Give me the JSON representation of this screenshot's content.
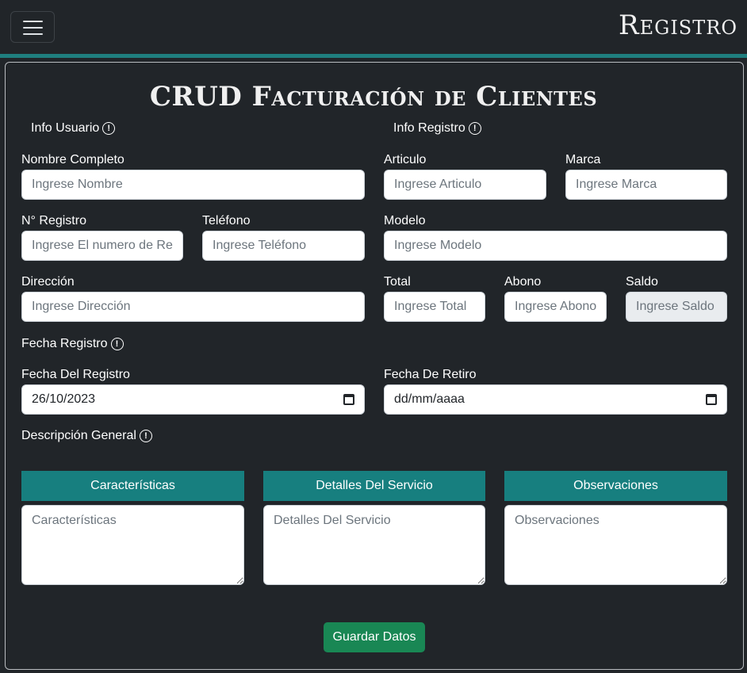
{
  "navbar": {
    "brand": "Registro",
    "menu_icon": "hamburger-menu-icon"
  },
  "page": {
    "title": "CRUD Facturación de Clientes"
  },
  "sections": {
    "info_usuario": "Info Usuario",
    "info_registro": "Info Registro",
    "fecha_registro": "Fecha Registro",
    "descripcion_general": "Descripción General",
    "icon": "info-circle-icon"
  },
  "fields": {
    "nombre": {
      "label": "Nombre Completo",
      "placeholder": "Ingrese Nombre"
    },
    "registro": {
      "label": "N° Registro",
      "placeholder": "Ingrese El numero de Registro"
    },
    "telefono": {
      "label": "Teléfono",
      "placeholder": "Ingrese Teléfono"
    },
    "direccion": {
      "label": "Dirección",
      "placeholder": "Ingrese Dirección"
    },
    "articulo": {
      "label": "Articulo",
      "placeholder": "Ingrese Articulo"
    },
    "marca": {
      "label": "Marca",
      "placeholder": "Ingrese Marca"
    },
    "modelo": {
      "label": "Modelo",
      "placeholder": "Ingrese Modelo"
    },
    "total": {
      "label": "Total",
      "placeholder": "Ingrese Total"
    },
    "abono": {
      "label": "Abono",
      "placeholder": "Ingrese Abono"
    },
    "saldo": {
      "label": "Saldo",
      "placeholder": "Ingrese Saldo"
    },
    "fecha_del_registro": {
      "label": "Fecha Del Registro",
      "value": "26/10/2023"
    },
    "fecha_de_retiro": {
      "label": "Fecha De Retiro",
      "value": "dd/mm/aaaa"
    }
  },
  "descripcion": {
    "caracteristicas": {
      "tab": "Características",
      "placeholder": "Características"
    },
    "detalles": {
      "tab": "Detalles Del Servicio",
      "placeholder": "Detalles Del Servicio"
    },
    "observaciones": {
      "tab": "Observaciones",
      "placeholder": "Observaciones"
    }
  },
  "actions": {
    "save_label": "Guardar Datos"
  },
  "colors": {
    "background": "#212529",
    "accent_teal": "#177f7f",
    "save_green": "#198754"
  }
}
